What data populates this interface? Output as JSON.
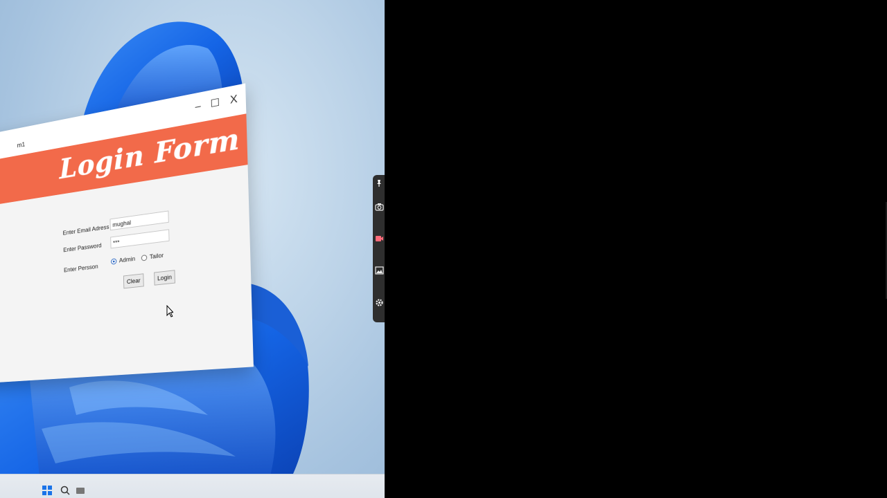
{
  "window": {
    "title": "m1",
    "controls": {
      "minimize": "–",
      "maximize": "☐",
      "close": "X"
    }
  },
  "banner": {
    "title": "Login Form"
  },
  "form": {
    "email_label": "Enter Email Adress",
    "email_value": "mughal",
    "password_label": "Enter Password",
    "password_value": "***",
    "person_label": "Enter Persson",
    "person_options": [
      {
        "label": "Admin",
        "selected": true
      },
      {
        "label": "Tailor",
        "selected": false
      }
    ],
    "clear_button": "Clear",
    "login_button": "Login"
  },
  "side_panel": {
    "icons": [
      "pin-icon",
      "camera-icon",
      "record-icon",
      "image-icon",
      "gear-icon"
    ],
    "record_color": "#ff6b7a"
  },
  "colors": {
    "banner": "#f26a4a",
    "radio_selected": "#1f5fbf",
    "wallpaper_blue": "#1466e0"
  }
}
